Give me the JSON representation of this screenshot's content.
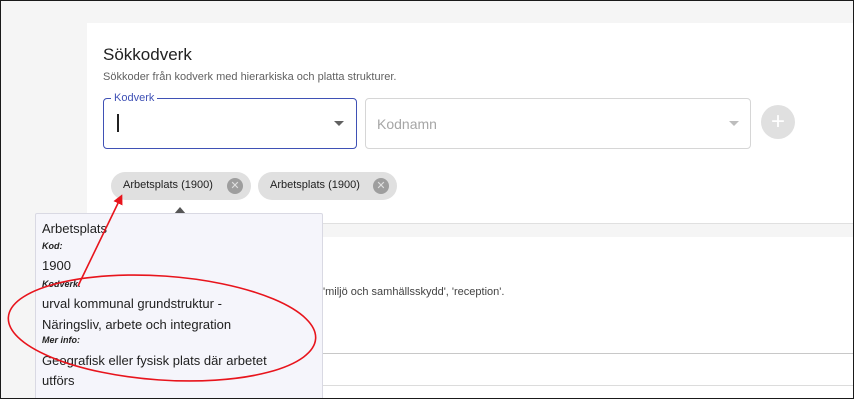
{
  "search_panel": {
    "title": "Sökkodverk",
    "subtitle": "Sökkoder från kodverk med hierarkiska och platta strukturer.",
    "kodverk_label": "Kodverk",
    "kodverk_value": "",
    "kodnamn_placeholder": "Kodnamn",
    "add_button": "+"
  },
  "chips": [
    {
      "label": "Arbetsplats (1900)"
    },
    {
      "label": "Arbetsplats (1900)"
    }
  ],
  "background_text": "'miljö och samhällsskydd', 'reception'.",
  "tooltip": {
    "name": "Arbetsplats",
    "kod_heading": "Kod:",
    "kod_value": "1900",
    "kodverk_heading": "Kodverk:",
    "kodverk_line1": "urval kommunal grundstruktur -",
    "kodverk_line2": "Näringsliv, arbete och integration",
    "merinfo_heading": "Mer info:",
    "merinfo_line1": "Geografisk eller fysisk plats där arbetet",
    "merinfo_line2": "utförs"
  },
  "colors": {
    "focus_accent": "#3f51b5",
    "annotation_red": "#e8141c",
    "chip_bg": "#e0e0e0",
    "tooltip_bg": "#f5f5fb"
  },
  "icons": {
    "dropdown": "chevron-down",
    "add": "plus",
    "chip_remove": "close-circle"
  }
}
